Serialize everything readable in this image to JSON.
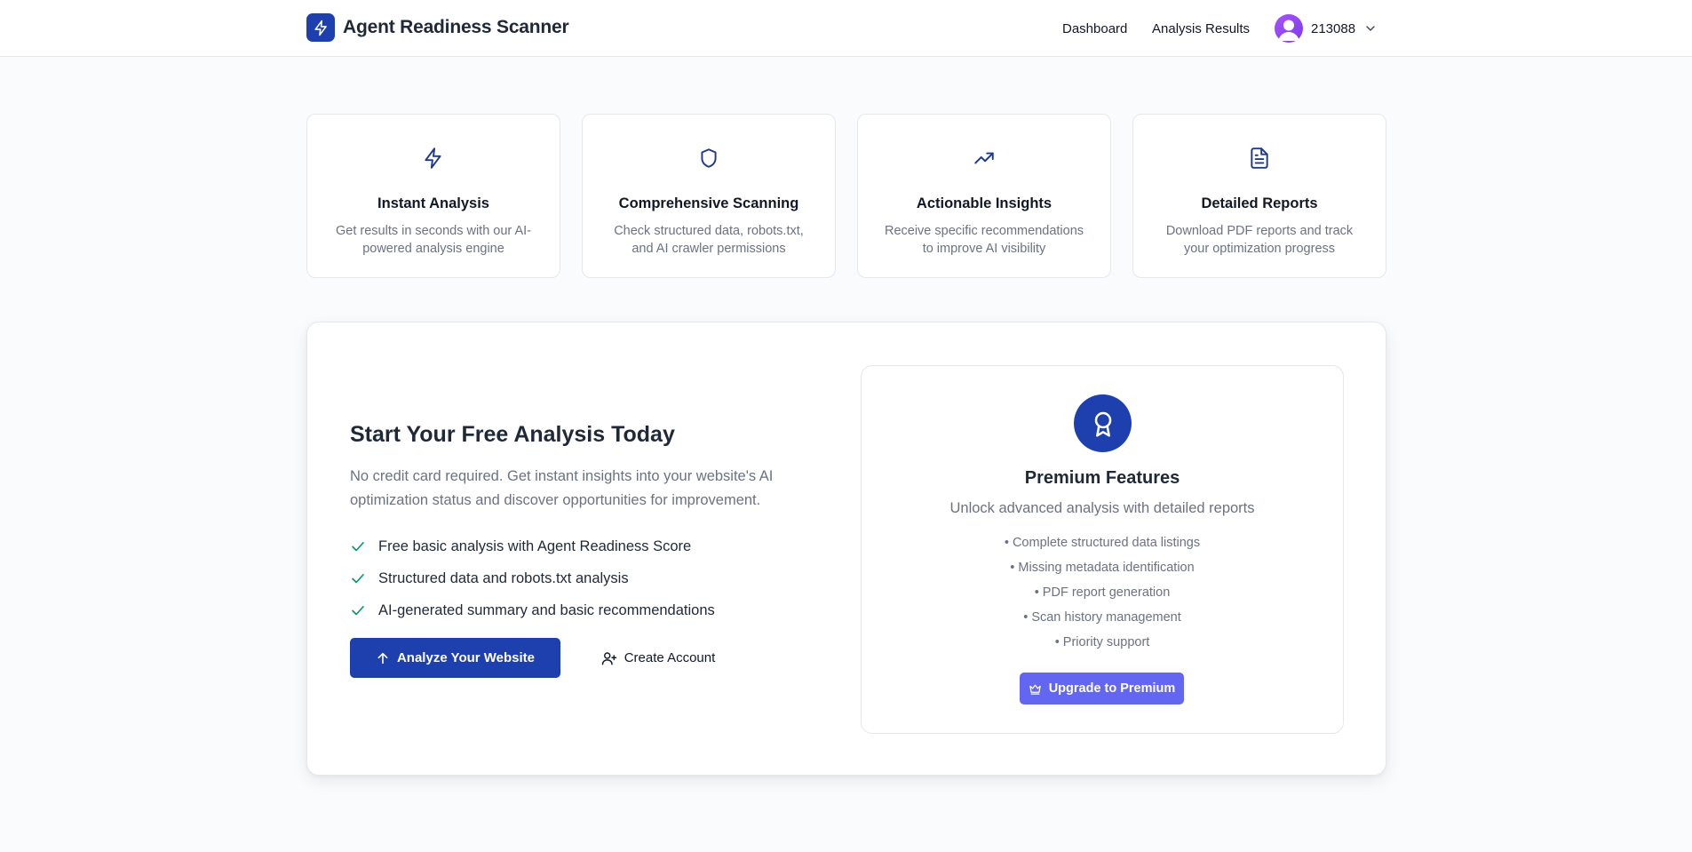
{
  "header": {
    "brand_name": "Agent Readiness Scanner",
    "brand_icon": "lightning-icon",
    "nav": {
      "dashboard": "Dashboard",
      "analysis_results": "Analysis Results"
    },
    "user": {
      "id": "213088",
      "avatar_icon": "user-avatar-icon",
      "menu_icon": "chevron-down-icon"
    }
  },
  "features": [
    {
      "icon": "lightning-icon",
      "title": "Instant Analysis",
      "description": "Get results in seconds with our AI-powered analysis engine"
    },
    {
      "icon": "shield-icon",
      "title": "Comprehensive Scanning",
      "description": "Check structured data, robots.txt, and AI crawler permissions"
    },
    {
      "icon": "trending-up-icon",
      "title": "Actionable Insights",
      "description": "Receive specific recommendations to improve AI visibility"
    },
    {
      "icon": "document-icon",
      "title": "Detailed Reports",
      "description": "Download PDF reports and track your optimization progress"
    }
  ],
  "cta": {
    "title": "Start Your Free Analysis Today",
    "description": "No credit card required. Get instant insights into your website's AI optimization status and discover opportunities for improvement.",
    "checklist": [
      "Free basic analysis with Agent Readiness Score",
      "Structured data and robots.txt analysis",
      "AI-generated summary and basic recommendations"
    ],
    "primary_button": "Analyze Your Website",
    "secondary_button": "Create Account"
  },
  "premium": {
    "icon": "award-icon",
    "title": "Premium Features",
    "subtitle": "Unlock advanced analysis with detailed reports",
    "items": [
      "• Complete structured data listings",
      "• Missing metadata identification",
      "• PDF report generation",
      "• Scan history management",
      "• Priority support"
    ],
    "button": "Upgrade to Premium",
    "button_icon": "crown-icon"
  },
  "colors": {
    "brand": "#1e40af",
    "premium_button": "#6366f1",
    "check": "#059669",
    "muted_text": "#6b7280"
  }
}
